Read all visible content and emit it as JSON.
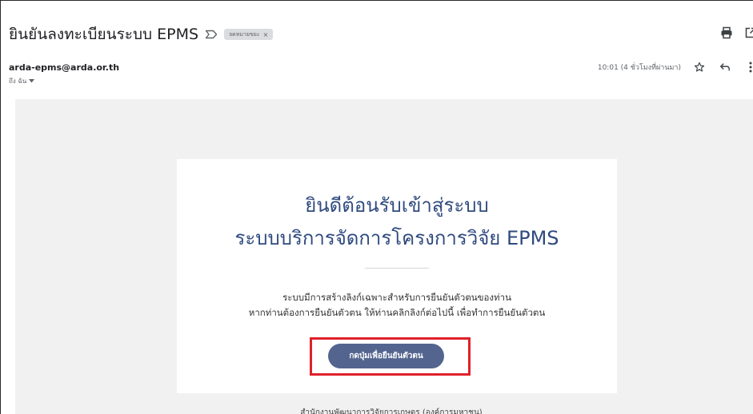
{
  "email": {
    "subject": "ยินยันลงทะเบียนระบบ EPMS",
    "label_chip": "จดหมายขยะ",
    "label_chip_close": "×",
    "sender": "arda-epms@arda.or.th",
    "recipient": "ถึง ฉัน",
    "timestamp": "10:01 (4 ชั่วโมงที่ผ่านมา)"
  },
  "icons": {
    "important": "important-marker-icon",
    "print": "print-icon",
    "new_window": "open-in-new-window-icon",
    "star": "star-icon",
    "reply": "reply-icon",
    "more": "more-vert-icon",
    "recipient_dropdown": "chevron-down-icon"
  },
  "card": {
    "title_line1": "ยินดีต้อนรับเข้าสู่ระบบ",
    "title_line2": "ระบบบริการจัดการโครงการวิจัย EPMS",
    "desc_line1": "ระบบมีการสร้างลิงก์เฉพาะสำหรับการยืนยันตัวตนของท่าน",
    "desc_line2": "หากท่านต้องการยืนยันตัวตน ให้ท่านคลิกลิงก์ต่อไปนี้ เพื่อทำการยืนยันตัวตน",
    "button_label": "กดปุ่มเพื่อยืนยันตัวตน"
  },
  "footer": {
    "org_name": "สำนักงานพัฒนาการวิจัยการเกษตร (องค์การมหาชน)"
  },
  "colors": {
    "title": "#2f4a7e",
    "button_bg": "#53648f",
    "highlight": "#e0202a",
    "body_bg": "#f1f1f1"
  }
}
